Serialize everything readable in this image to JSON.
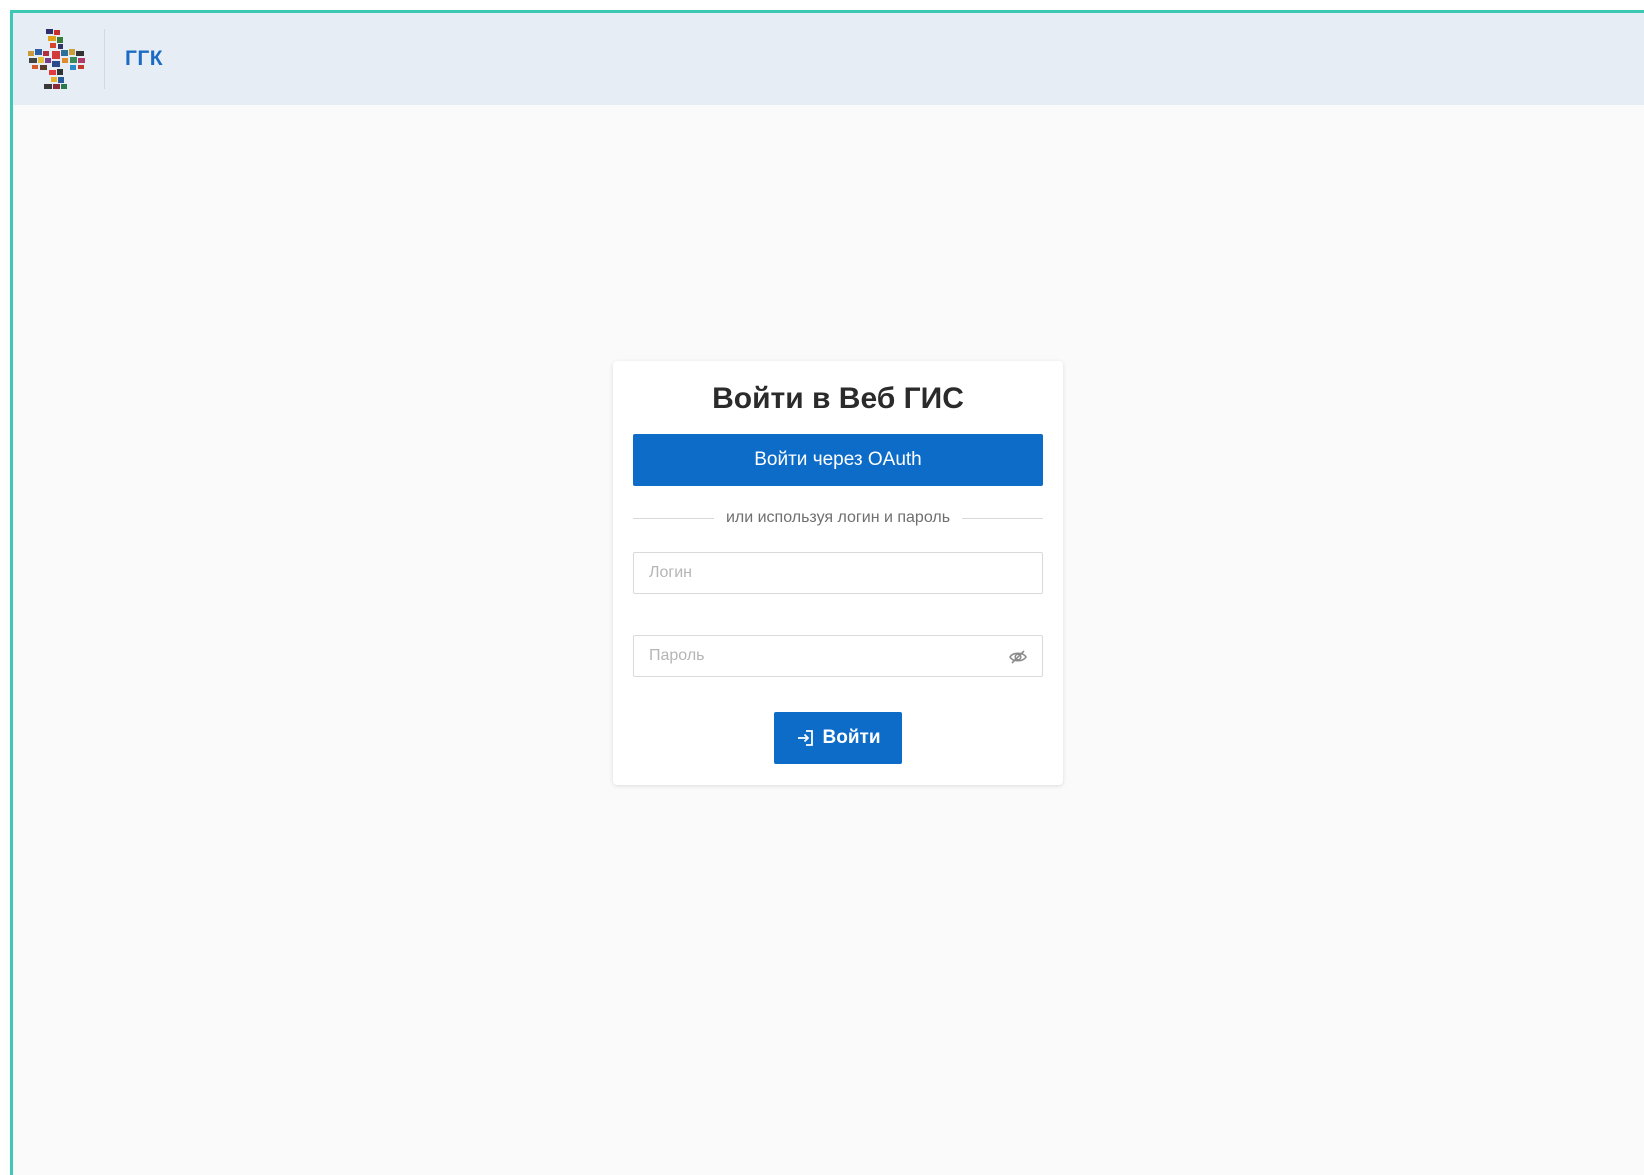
{
  "header": {
    "app_name": "ГГК",
    "logo_icon": "mosaic-cross-logo"
  },
  "login": {
    "title": "Войти в Веб ГИС",
    "oauth_label": "Войти через OAuth",
    "separator_text": "или используя логин и пароль",
    "login_placeholder": "Логин",
    "login_value": "",
    "password_placeholder": "Пароль",
    "password_value": "",
    "password_toggle_icon": "eye-slash-icon",
    "submit_label": "Войти",
    "submit_icon": "sign-in-icon"
  },
  "colors": {
    "accent": "#0d6cc8",
    "header_bg": "#e6edf5",
    "app_name": "#1a6bc4",
    "frame_border": "#3cc8b4"
  }
}
